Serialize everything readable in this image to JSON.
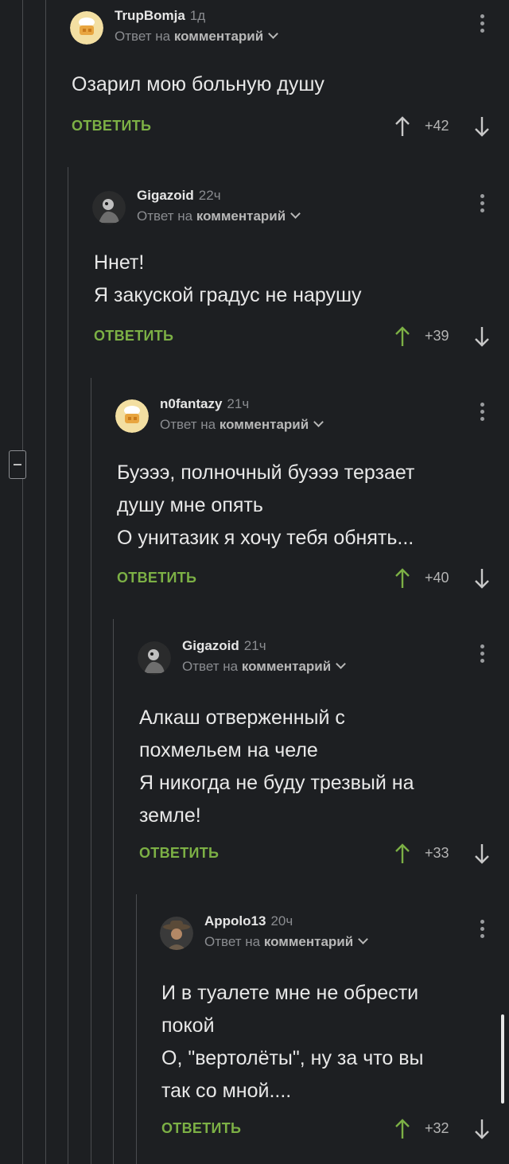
{
  "comments": [
    {
      "author": "TrupBomja",
      "time": "1д",
      "reply_prefix": "Ответ на",
      "reply_target": "комментарий",
      "text": "Озарил мою больную душу",
      "reply_label": "ОТВЕТИТЬ",
      "score": "+42",
      "avatar_icon": "chef-icon"
    },
    {
      "author": "Gigazoid",
      "time": "22ч",
      "reply_prefix": "Ответ на",
      "reply_target": "комментарий",
      "text": "Ннет!\nЯ закуской градус не нарушу",
      "reply_label": "ОТВЕТИТЬ",
      "score": "+39",
      "avatar_icon": "figure-icon"
    },
    {
      "author": "n0fantazy",
      "time": "21ч",
      "reply_prefix": "Ответ на",
      "reply_target": "комментарий",
      "text": "Буэээ, полночный буэээ терзает\nдушу мне опять\nО унитазик я хочу тебя обнять...",
      "reply_label": "ОТВЕТИТЬ",
      "score": "+40",
      "avatar_icon": "chef-icon"
    },
    {
      "author": "Gigazoid",
      "time": "21ч",
      "reply_prefix": "Ответ на",
      "reply_target": "комментарий",
      "text": "Алкаш отверженный с\nпохмельем на челе\nЯ никогда не буду трезвый на\nземле!",
      "reply_label": "ОТВЕТИТЬ",
      "score": "+33",
      "avatar_icon": "figure-icon"
    },
    {
      "author": "Appolo13",
      "time": "20ч",
      "reply_prefix": "Ответ на",
      "reply_target": "комментарий",
      "text": "И в туалете мне не обрести\nпокой\nО, \"вертолёты\", ну за что вы\nтак со мной....",
      "reply_label": "ОТВЕТИТЬ",
      "score": "+32",
      "avatar_icon": "cowboy-icon"
    }
  ],
  "colors": {
    "background": "#1d1f22",
    "reply_button": "#7cb045",
    "upvote_active": "#7cb045",
    "thread_line": "#4a4c50"
  }
}
